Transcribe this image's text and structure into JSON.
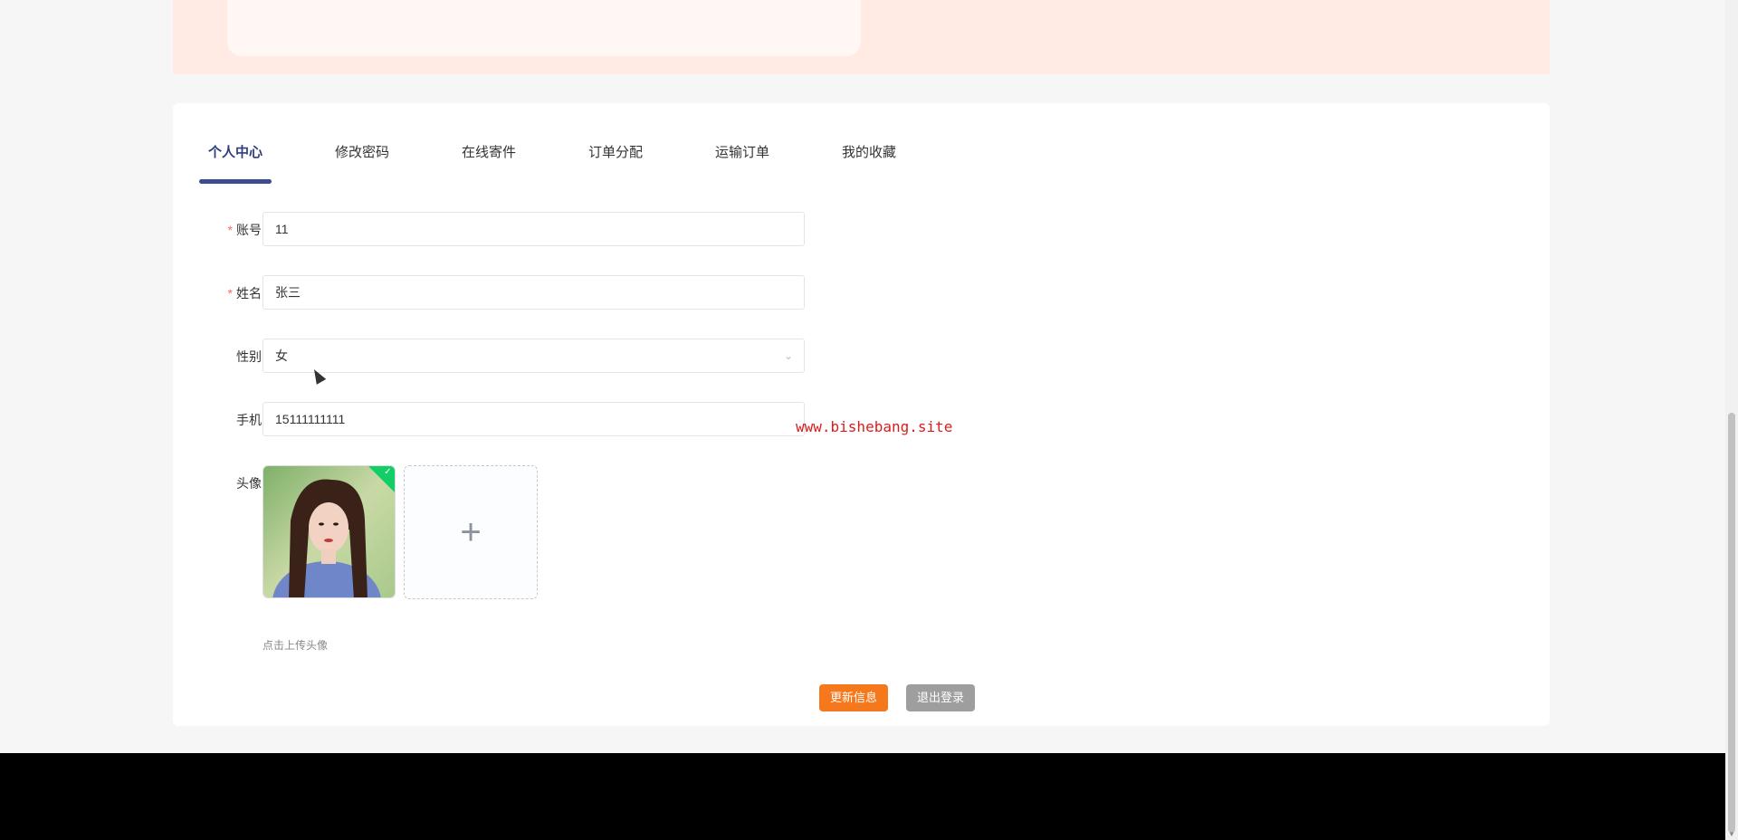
{
  "tabs": [
    {
      "label": "个人中心",
      "active": true
    },
    {
      "label": "修改密码",
      "active": false
    },
    {
      "label": "在线寄件",
      "active": false
    },
    {
      "label": "订单分配",
      "active": false
    },
    {
      "label": "运输订单",
      "active": false
    },
    {
      "label": "我的收藏",
      "active": false
    }
  ],
  "form": {
    "account": {
      "label": "账号",
      "required_mark": "*",
      "value": "11"
    },
    "name": {
      "label": "姓名",
      "required_mark": "*",
      "value": "张三"
    },
    "gender": {
      "label": "性别",
      "value": "女",
      "arrow_icon": "chevron-down-icon"
    },
    "phone": {
      "label": "手机",
      "value": "15111111111"
    },
    "avatar": {
      "label": "头像",
      "upload_plus": "+",
      "hint": "点击上传头像",
      "check_mark": "✓"
    }
  },
  "buttons": {
    "update": "更新信息",
    "logout": "退出登录"
  },
  "watermark": "www.bishebang.site",
  "colors": {
    "accent_orange": "#f6781c",
    "tab_active": "#2e3f7e",
    "logout_gray": "#9e9e9e",
    "required_red": "#f56c6c",
    "banner_peach": "#ffebe3",
    "upload_success_green": "#13ce66"
  }
}
